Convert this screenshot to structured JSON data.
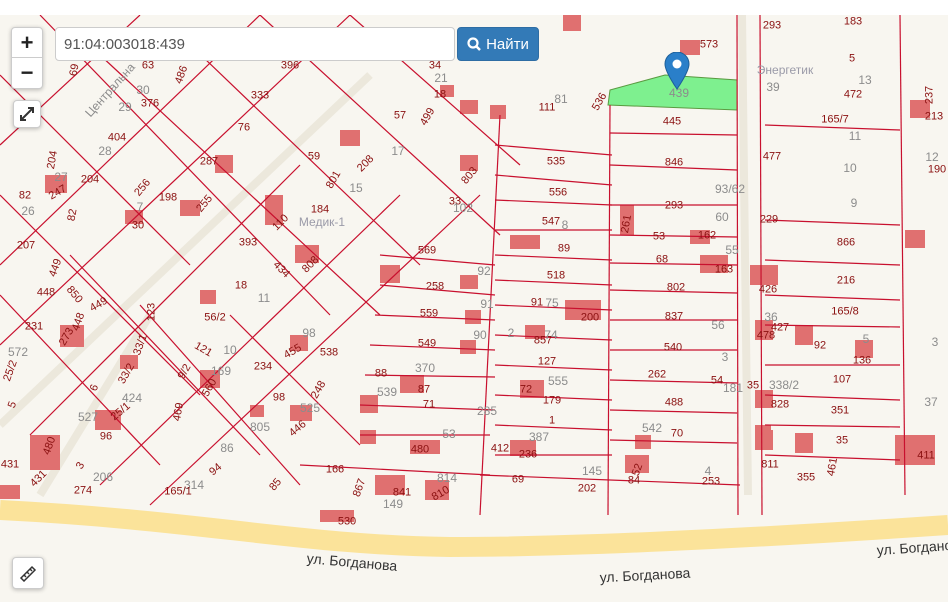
{
  "search": {
    "value": "91:04:003018:439",
    "button_label": "Найти",
    "icon": "search-icon"
  },
  "controls": {
    "zoom_in": "+",
    "zoom_out": "−",
    "fullscreen_icon": "expand-icon",
    "ruler_icon": "ruler-icon"
  },
  "colors": {
    "parcel_line": "#c8102e",
    "selected_parcel": "#7ef08f",
    "road": "#fbe39a",
    "building": "#e07070",
    "button": "#337ab7",
    "pin": "#2a7fc9"
  },
  "selected_parcel": "439",
  "streets": [
    "ул. Богданова",
    "ул. Богданова",
    "ул. Богданова",
    "Центральна",
    "Энергетик",
    "Медик-1"
  ],
  "labels": [
    "69",
    "10",
    "63",
    "486",
    "396",
    "34",
    "21",
    "30",
    "29",
    "376",
    "333",
    "18",
    "57",
    "499",
    "111",
    "81",
    "536",
    "573",
    "445",
    "293",
    "183",
    "5",
    "13",
    "472",
    "165/7",
    "39",
    "237",
    "213",
    "12",
    "190",
    "11",
    "10",
    "9",
    "866",
    "216",
    "165/8",
    "92",
    "136",
    "5",
    "107",
    "351",
    "35",
    "355",
    "461",
    "411",
    "37",
    "3",
    "404",
    "28",
    "76",
    "17",
    "287",
    "59",
    "208",
    "801",
    "15",
    "803",
    "535",
    "846",
    "477",
    "204",
    "204",
    "27",
    "247",
    "82",
    "26",
    "82",
    "256",
    "198",
    "7",
    "255",
    "30",
    "110",
    "184",
    "33",
    "102",
    "556",
    "293",
    "93/62",
    "547",
    "8",
    "261",
    "53",
    "60",
    "162",
    "229",
    "207",
    "393",
    "808",
    "569",
    "89",
    "68",
    "163",
    "55",
    "426",
    "449",
    "850",
    "449",
    "448",
    "434",
    "18",
    "11",
    "258",
    "92",
    "518",
    "802",
    "231",
    "448",
    "273",
    "123",
    "56/2",
    "559",
    "91",
    "91",
    "200",
    "837",
    "36",
    "427",
    "478",
    "56",
    "33/1",
    "121",
    "10",
    "98",
    "455",
    "538",
    "549",
    "90",
    "2",
    "857",
    "74",
    "75",
    "540",
    "3",
    "572",
    "25/2",
    "33/2",
    "9/2",
    "169",
    "234",
    "88",
    "370",
    "127",
    "262",
    "54",
    "181",
    "35",
    "338/2",
    "6",
    "424",
    "560",
    "248",
    "87",
    "539",
    "72",
    "555",
    "179",
    "488",
    "828",
    "5",
    "527",
    "25/1",
    "469",
    "98",
    "525",
    "446",
    "71",
    "285",
    "1",
    "805",
    "96",
    "86",
    "53",
    "542",
    "70",
    "387",
    "412",
    "236",
    "52",
    "4",
    "253",
    "811",
    "480",
    "480",
    "3",
    "206",
    "431",
    "431",
    "274",
    "166",
    "94",
    "314",
    "165/1",
    "85",
    "814",
    "841",
    "810",
    "867",
    "69",
    "145",
    "202",
    "84",
    "149",
    "530"
  ]
}
